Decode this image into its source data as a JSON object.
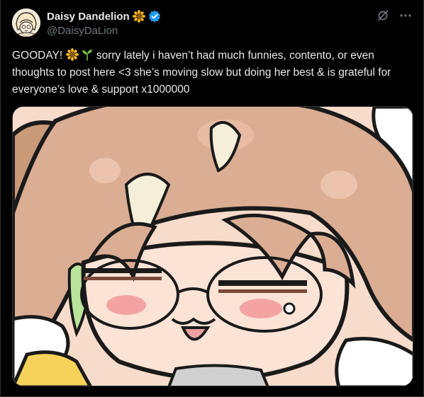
{
  "author": {
    "display_name": "Daisy Dandelion",
    "handle": "@DaisyDaLion",
    "badge_icon": "sunflower-icon",
    "verified_icon": "verified-badge-icon",
    "verified_color": "#1d9bf0"
  },
  "post": {
    "text_part1": "GOODAY! ",
    "emoji_1": "sunflower-icon",
    "emoji_2": "seedling-icon",
    "text_part2": " sorry lately i haven’t had much funnies, contento, or even thoughts to post here <3 she’s moving slow but doing her best & is grateful for everyone’s love & support x1000000"
  },
  "actions": {
    "grok_icon": "grok-icon",
    "more_icon": "more-options-icon"
  },
  "media": {
    "type": "image",
    "subject": "chibi-character-artwork"
  },
  "colors": {
    "background": "#000000",
    "text": "#e7e9ea",
    "muted": "#71767b",
    "border": "#2f3336"
  }
}
